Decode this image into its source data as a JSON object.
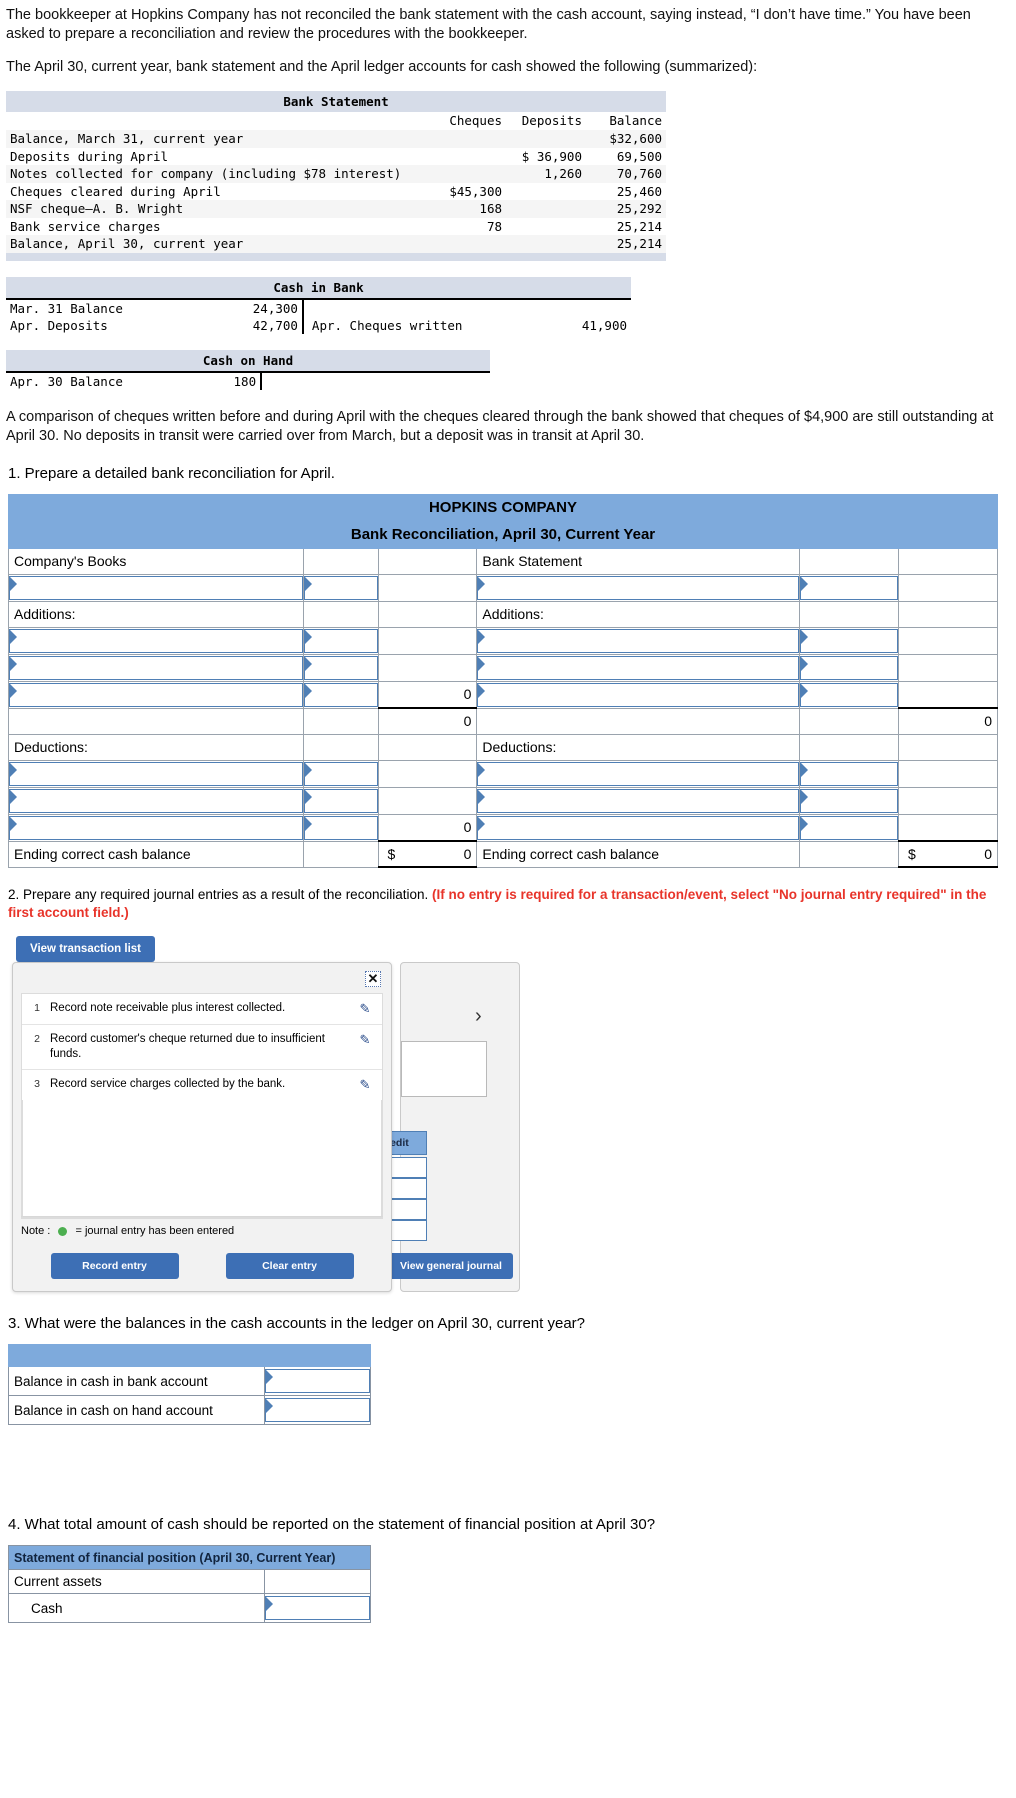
{
  "intro": {
    "p1": "The bookkeeper at Hopkins Company has not reconciled the bank statement with the cash account, saying instead, “I don’t have time.” You have been asked to prepare a reconciliation and review the procedures with the bookkeeper.",
    "p2": "The April 30, current year, bank statement and the April ledger accounts for cash showed the following (summarized):"
  },
  "bank_statement": {
    "title": "Bank Statement",
    "columns": [
      "Cheques",
      "Deposits",
      "Balance"
    ],
    "rows": [
      {
        "label": "Balance, March 31, current year",
        "cheques": "",
        "deposits": "",
        "balance": "$32,600"
      },
      {
        "label": "Deposits during April",
        "cheques": "",
        "deposits": "$ 36,900",
        "balance": "69,500"
      },
      {
        "label": "Notes collected for company (including $78 interest)",
        "cheques": "",
        "deposits": "1,260",
        "balance": "70,760"
      },
      {
        "label": "Cheques cleared during April",
        "cheques": "$45,300",
        "deposits": "",
        "balance": "25,460"
      },
      {
        "label": "NSF cheque—A. B. Wright",
        "cheques": "168",
        "deposits": "",
        "balance": "25,292"
      },
      {
        "label": "Bank service charges",
        "cheques": "78",
        "deposits": "",
        "balance": "25,214"
      },
      {
        "label": "Balance, April 30, current year",
        "cheques": "",
        "deposits": "",
        "balance": "25,214"
      }
    ]
  },
  "cash_in_bank": {
    "title": "Cash in Bank",
    "debits": [
      {
        "label": "Mar. 31 Balance",
        "amount": "24,300"
      },
      {
        "label": "Apr. Deposits",
        "amount": "42,700"
      }
    ],
    "credits": [
      {
        "label": "",
        "amount": ""
      },
      {
        "label": "Apr. Cheques written",
        "amount": "41,900"
      }
    ]
  },
  "cash_on_hand": {
    "title": "Cash on Hand",
    "debits": [
      {
        "label": "Apr. 30 Balance",
        "amount": "180"
      }
    ]
  },
  "comparison_note": "A comparison of cheques written before and during April with the cheques cleared through the bank showed that cheques of $4,900 are still outstanding at April 30. No deposits in transit were carried over from March, but a deposit was in transit at April 30.",
  "q1": {
    "prompt": "1. Prepare a detailed bank reconciliation for April.",
    "company_title": "HOPKINS COMPANY",
    "subtitle": "Bank Reconciliation, April 30, Current Year",
    "left_header": "Company's Books",
    "right_header": "Bank Statement",
    "additions_label": "Additions:",
    "deductions_label": "Deductions:",
    "ending_label": "Ending correct cash balance",
    "dollar": "$",
    "zero": "0",
    "left_additions_subtotal": "0",
    "left_additions_total": "0",
    "right_additions_total": "0",
    "left_deductions_subtotal": "0",
    "left_ending_value": "0",
    "right_ending_value": "0"
  },
  "q2": {
    "prompt_black": "2. Prepare any required journal entries as a result of the reconciliation.",
    "prompt_red": "(If no entry is required for a transaction/event, select \"No journal entry required\" in the first account field.)",
    "view_button": "View transaction list",
    "close_icon": "✕",
    "transactions": [
      {
        "num": "1",
        "desc": "Record note receivable plus interest collected."
      },
      {
        "num": "2",
        "desc": "Record customer's cheque returned due to insufficient funds."
      },
      {
        "num": "3",
        "desc": "Record service charges collected by the bank."
      }
    ],
    "note_prefix": "Note :",
    "note_suffix": "= journal entry has been entered",
    "record_entry": "Record entry",
    "clear_entry": "Clear entry",
    "view_general_journal": "View general journal",
    "credit_header": "redit"
  },
  "q3": {
    "prompt": "3. What were the balances in the cash accounts in the ledger on April 30, current year?",
    "rows": [
      {
        "label": "Balance in cash in bank account",
        "value": ""
      },
      {
        "label": "Balance in cash on hand account",
        "value": ""
      }
    ]
  },
  "q4": {
    "prompt": "4. What total amount of cash should be reported on the statement of financial position at April 30?",
    "header": "Statement of financial position (April 30, Current Year)",
    "rows": [
      {
        "label": "Current assets",
        "value": "",
        "indent": false
      },
      {
        "label": "Cash",
        "value": "",
        "indent": true
      }
    ]
  },
  "colors": {
    "blue_header": "#7eaadc",
    "input_border": "#4f7fb5",
    "button_blue": "#3d6fb5",
    "red_text": "#e8342a",
    "mono_header_bg": "#d6dce8"
  }
}
